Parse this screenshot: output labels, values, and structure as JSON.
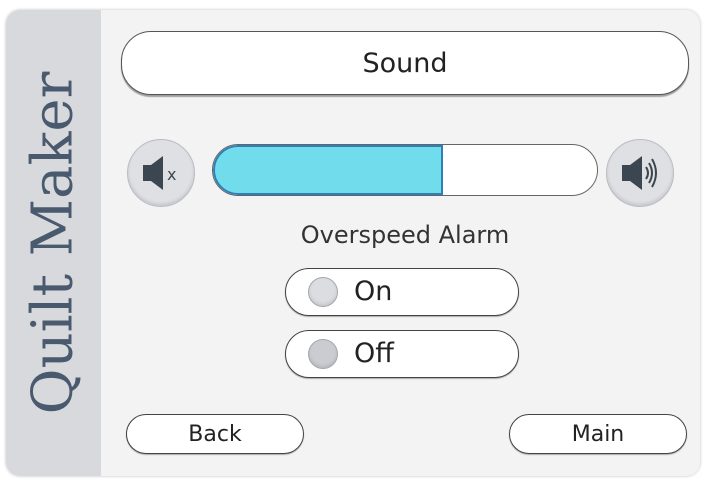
{
  "brand": {
    "name": "Quilt Maker"
  },
  "title": "Sound",
  "volume": {
    "level_percent": 60,
    "fill_color": "#70dcec",
    "border_color": "#2f7fb6"
  },
  "mute_button": {
    "icon": "speaker-mute-icon"
  },
  "loud_button": {
    "icon": "speaker-loud-icon"
  },
  "alarm": {
    "label": "Overspeed Alarm",
    "options": [
      {
        "label": "On",
        "selected": false
      },
      {
        "label": "Off",
        "selected": false
      }
    ]
  },
  "nav": {
    "back_label": "Back",
    "main_label": "Main"
  }
}
